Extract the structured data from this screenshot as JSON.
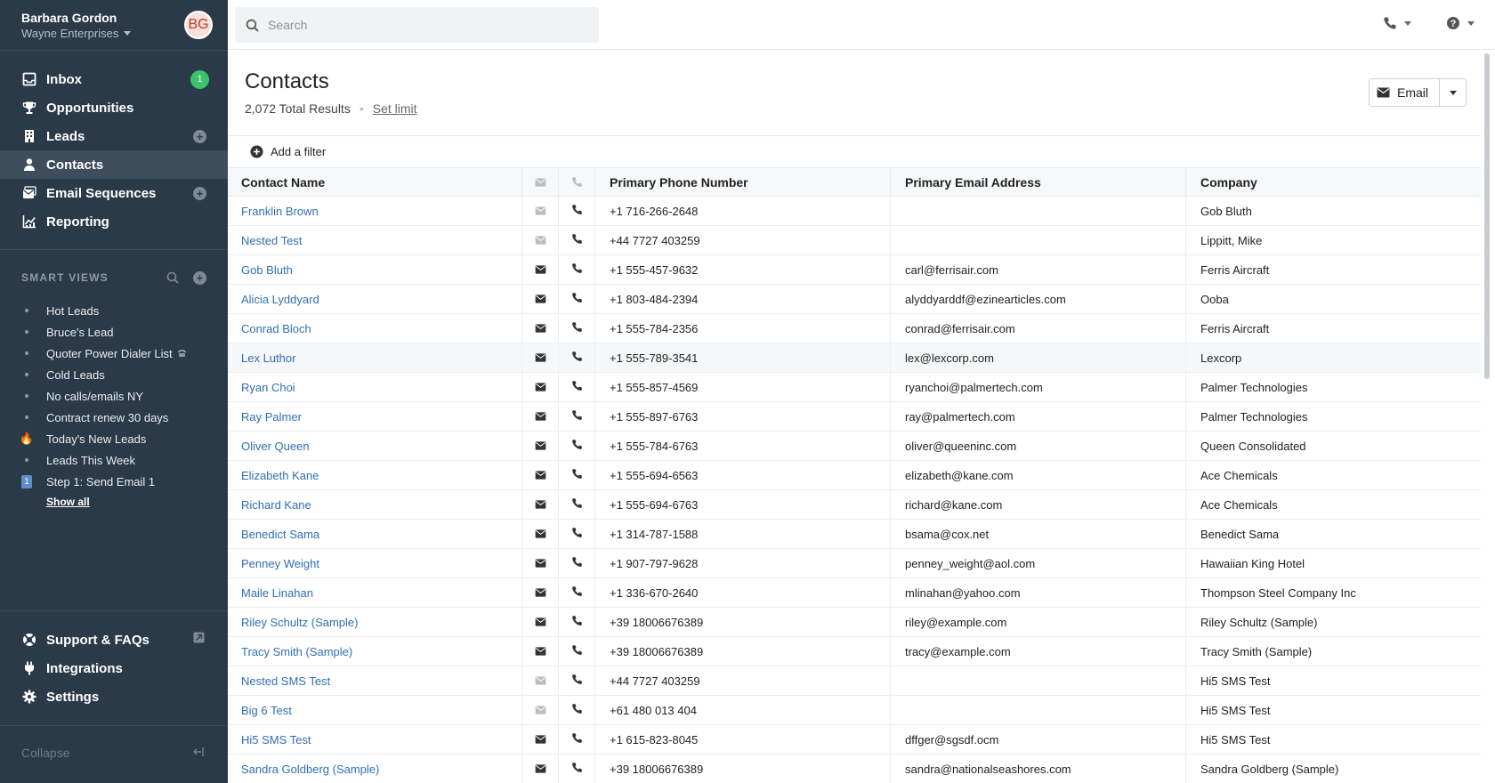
{
  "user": {
    "name": "Barbara Gordon",
    "org": "Wayne Enterprises",
    "initials": "BG"
  },
  "nav": [
    {
      "label": "Inbox",
      "icon": "inbox-icon",
      "badge": "1"
    },
    {
      "label": "Opportunities",
      "icon": "trophy-icon"
    },
    {
      "label": "Leads",
      "icon": "building-icon",
      "add": true
    },
    {
      "label": "Contacts",
      "icon": "person-icon",
      "active": true
    },
    {
      "label": "Email Sequences",
      "icon": "email-sequence-icon",
      "add": true
    },
    {
      "label": "Reporting",
      "icon": "chart-icon"
    }
  ],
  "smart_views": {
    "header": "SMART VIEWS",
    "items": [
      {
        "label": "Hot Leads",
        "marker": "dot"
      },
      {
        "label": "Bruce's Lead",
        "marker": "dot"
      },
      {
        "label": "Quoter Power Dialer List",
        "marker": "dot",
        "suffix": "phone-icon"
      },
      {
        "label": "Cold Leads",
        "marker": "dot"
      },
      {
        "label": "No calls/emails NY",
        "marker": "dot"
      },
      {
        "label": "Contract renew 30 days",
        "marker": "dot"
      },
      {
        "label": "Today's New Leads",
        "marker": "fire",
        "emoji": "🔥"
      },
      {
        "label": "Leads This Week",
        "marker": "dot"
      },
      {
        "label": "Step 1: Send Email 1",
        "marker": "number",
        "number": "1"
      }
    ],
    "show_all": "Show all"
  },
  "nav_bottom": [
    {
      "label": "Support & FAQs",
      "icon": "lifebuoy-icon",
      "external": true
    },
    {
      "label": "Integrations",
      "icon": "plug-icon"
    },
    {
      "label": "Settings",
      "icon": "gear-icon"
    }
  ],
  "collapse_label": "Collapse",
  "search": {
    "placeholder": "Search"
  },
  "page": {
    "title": "Contacts",
    "results": "2,072 Total Results",
    "set_limit": "Set limit",
    "email_button": "Email",
    "add_filter": "Add a filter"
  },
  "table": {
    "columns": [
      "Contact Name",
      "Primary Phone Number",
      "Primary Email Address",
      "Company"
    ],
    "rows": [
      {
        "name": "Franklin Brown",
        "phone": "+1 716-266-2648",
        "email": "",
        "company": "Gob Bluth"
      },
      {
        "name": "Nested Test",
        "phone": "+44 7727 403259",
        "email": "",
        "company": "Lippitt, Mike"
      },
      {
        "name": "Gob Bluth",
        "phone": "+1 555-457-9632",
        "email": "carl@ferrisair.com",
        "company": "Ferris Aircraft"
      },
      {
        "name": "Alicia Lyddyard",
        "phone": "+1 803-484-2394",
        "email": "alyddyarddf@ezinearticles.com",
        "company": "Ooba"
      },
      {
        "name": "Conrad Bloch",
        "phone": "+1 555-784-2356",
        "email": "conrad@ferrisair.com",
        "company": "Ferris Aircraft"
      },
      {
        "name": "Lex Luthor",
        "phone": "+1 555-789-3541",
        "email": "lex@lexcorp.com",
        "company": "Lexcorp",
        "highlight": true
      },
      {
        "name": "Ryan Choi",
        "phone": "+1 555-857-4569",
        "email": "ryanchoi@palmertech.com",
        "company": "Palmer Technologies"
      },
      {
        "name": "Ray Palmer",
        "phone": "+1 555-897-6763",
        "email": "ray@palmertech.com",
        "company": "Palmer Technologies"
      },
      {
        "name": "Oliver Queen",
        "phone": "+1 555-784-6763",
        "email": "oliver@queeninc.com",
        "company": "Queen Consolidated"
      },
      {
        "name": "Elizabeth Kane",
        "phone": "+1 555-694-6563",
        "email": "elizabeth@kane.com",
        "company": "Ace Chemicals"
      },
      {
        "name": "Richard Kane",
        "phone": "+1 555-694-6763",
        "email": "richard@kane.com",
        "company": "Ace Chemicals"
      },
      {
        "name": "Benedict Sama",
        "phone": "+1 314-787-1588",
        "email": "bsama@cox.net",
        "company": "Benedict Sama"
      },
      {
        "name": "Penney Weight",
        "phone": "+1 907-797-9628",
        "email": "penney_weight@aol.com",
        "company": "Hawaiian King Hotel"
      },
      {
        "name": "Maile Linahan",
        "phone": "+1 336-670-2640",
        "email": "mlinahan@yahoo.com",
        "company": "Thompson Steel Company Inc"
      },
      {
        "name": "Riley Schultz (Sample)",
        "phone": "+39 18006676389",
        "email": "riley@example.com",
        "company": "Riley Schultz (Sample)"
      },
      {
        "name": "Tracy Smith (Sample)",
        "phone": "+39 18006676389",
        "email": "tracy@example.com",
        "company": "Tracy Smith (Sample)"
      },
      {
        "name": "Nested SMS Test",
        "phone": "+44 7727 403259",
        "email": "",
        "company": "Hi5 SMS Test"
      },
      {
        "name": "Big 6 Test",
        "phone": "+61 480 013 404",
        "email": "",
        "company": "Hi5 SMS Test"
      },
      {
        "name": "Hi5 SMS Test",
        "phone": "+1 615-823-8045",
        "email": "dffger@sgsdf.ocm",
        "company": "Hi5 SMS Test"
      },
      {
        "name": "Sandra Goldberg (Sample)",
        "phone": "+39 18006676389",
        "email": "sandra@nationalseashores.com",
        "company": "Sandra Goldberg (Sample)"
      }
    ]
  },
  "colors": {
    "sidebar": "#2b3a48",
    "link": "#2f6fb5",
    "badge": "#3cc26c"
  }
}
